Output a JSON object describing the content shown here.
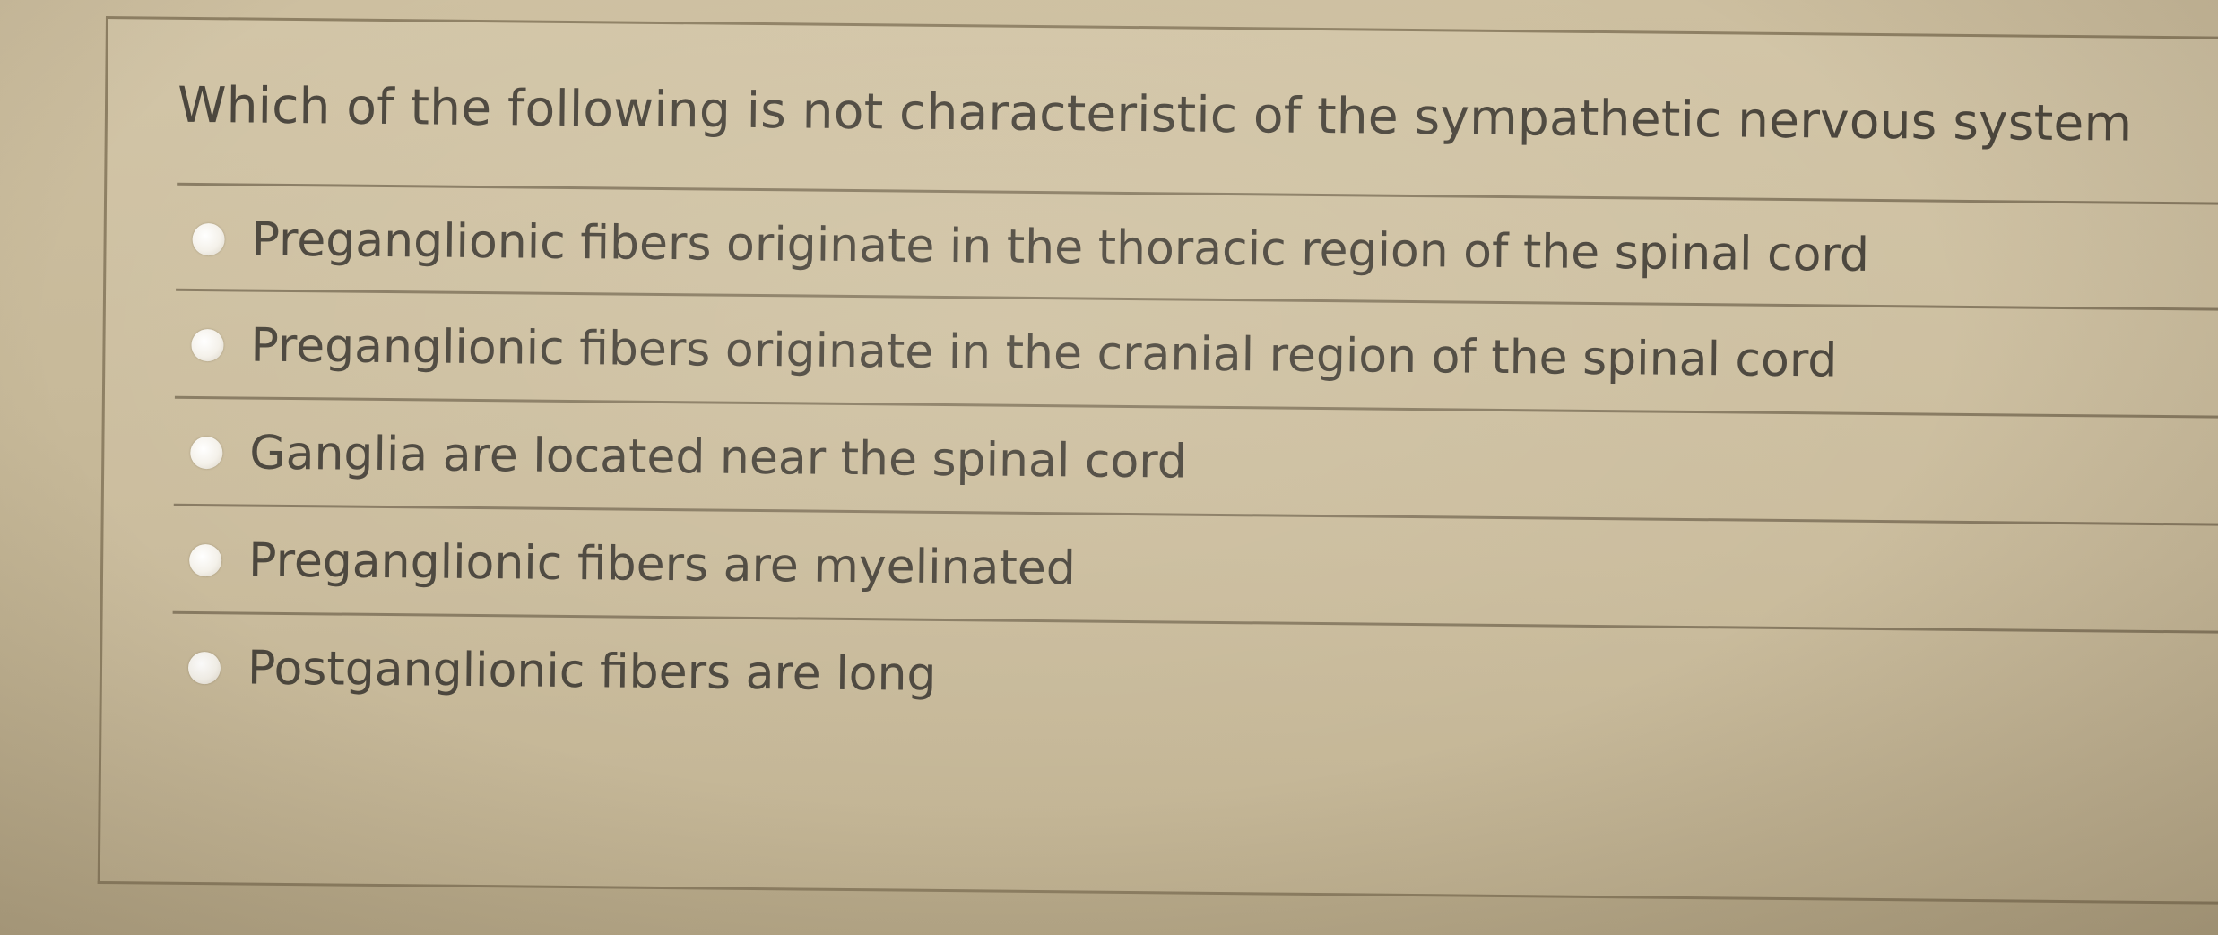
{
  "question": {
    "text": "Which of the following is not characteristic of the sympathetic nervous system"
  },
  "options": [
    {
      "label": "Preganglionic fibers originate in the thoracic region of the spinal cord",
      "selected": false
    },
    {
      "label": "Preganglionic fibers originate in the cranial region of the spinal cord",
      "selected": false
    },
    {
      "label": "Ganglia are located near the spinal cord",
      "selected": false
    },
    {
      "label": "Preganglionic fibers are myelinated",
      "selected": false
    },
    {
      "label": "Postganglionic fibers are long",
      "selected": false
    }
  ],
  "colors": {
    "text": "#4b463d",
    "background": "#c9bb9c",
    "divider": "#7d7058",
    "radio": "#f4f1ea"
  }
}
